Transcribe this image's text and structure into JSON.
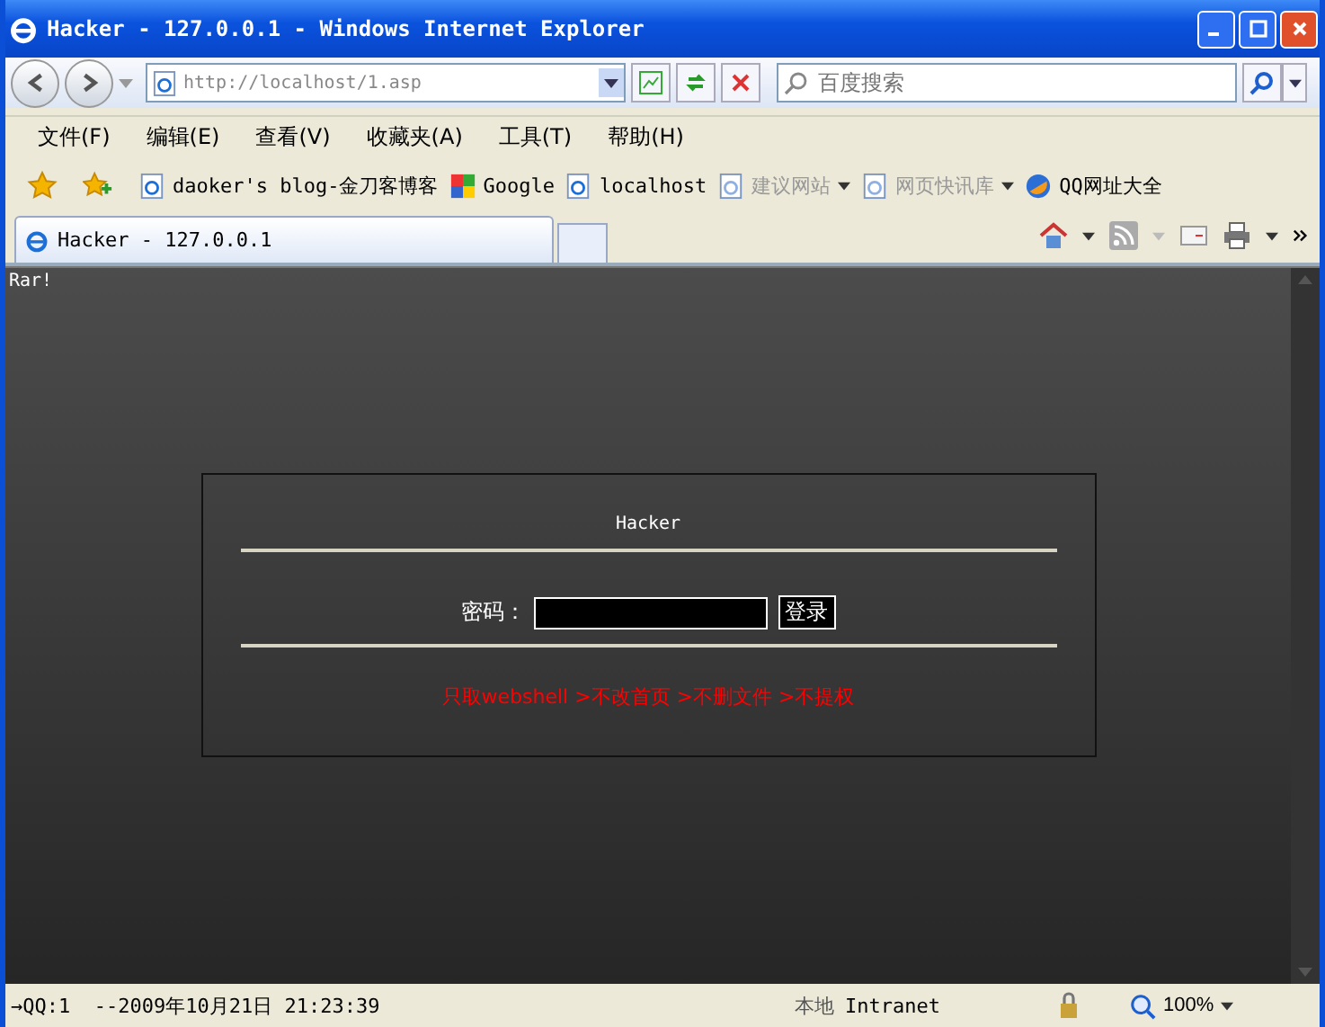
{
  "window": {
    "title": "Hacker - 127.0.0.1 - Windows Internet Explorer"
  },
  "address": {
    "url": "http://localhost/1.asp"
  },
  "search": {
    "placeholder": "百度搜索"
  },
  "menu": [
    "文件(F)",
    "编辑(E)",
    "查看(V)",
    "收藏夹(A)",
    "工具(T)",
    "帮助(H)"
  ],
  "favorites": [
    {
      "label": "daoker's blog-金刀客博客",
      "kind": "page",
      "disabled": false,
      "dropdown": false
    },
    {
      "label": "Google",
      "kind": "google",
      "disabled": false,
      "dropdown": false
    },
    {
      "label": "localhost",
      "kind": "page",
      "disabled": false,
      "dropdown": false
    },
    {
      "label": "建议网站",
      "kind": "page",
      "disabled": true,
      "dropdown": true
    },
    {
      "label": "网页快讯库",
      "kind": "page",
      "disabled": true,
      "dropdown": true
    },
    {
      "label": "QQ网址大全",
      "kind": "globe",
      "disabled": false,
      "dropdown": false
    }
  ],
  "tabs": [
    {
      "label": "Hacker - 127.0.0.1",
      "selected": true
    }
  ],
  "page": {
    "corner_text": "Rar!",
    "login_title": "Hacker",
    "password_label": "密码：",
    "login_button": "登录",
    "notice": "只取webshell >不改首页 >不删文件 >不提权"
  },
  "status_bar": {
    "text": "→QQ:1  --2009年10月21日 21:23:39",
    "zone": "本地",
    "zone_name": "Intranet",
    "zoom": "100%"
  }
}
